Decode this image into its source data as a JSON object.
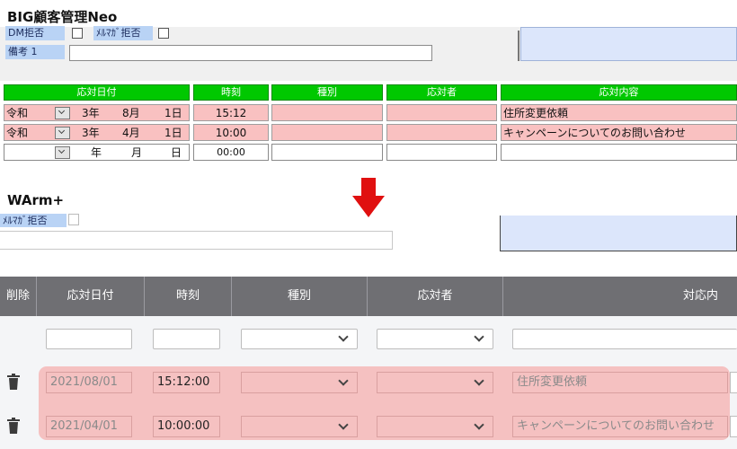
{
  "top": {
    "title": "BIG顧客管理Neo",
    "dm_label": "DM拒否",
    "mailmag_label": "ﾒﾙﾏｶﾞ拒否",
    "note_label": "備考 1",
    "headers": [
      "応対日付",
      "時刻",
      "種別",
      "応対者",
      "応対内容"
    ],
    "rows": [
      {
        "era": "令和",
        "year": "3年",
        "month": "8月",
        "day": "1日",
        "time": "15:12",
        "type": "",
        "staff": "",
        "content": "住所変更依頼"
      },
      {
        "era": "令和",
        "year": "3年",
        "month": "4月",
        "day": "1日",
        "time": "10:00",
        "type": "",
        "staff": "",
        "content": "キャンペーンについてのお問い合わせ"
      }
    ],
    "empty_row": {
      "year_unit": "年",
      "month_unit": "月",
      "day_unit": "日",
      "time": "00:00"
    }
  },
  "arrow": {
    "color": "#e01010"
  },
  "bottom": {
    "title": "WArm+",
    "mailmag_label": "ﾒﾙﾏｶﾞ拒否",
    "headers": [
      "削除",
      "応対日付",
      "時刻",
      "種別",
      "応対者",
      "対応内"
    ],
    "rows": [
      {
        "date": "2021/08/01",
        "time": "15:12:00",
        "type": "",
        "staff": "",
        "content": "住所変更依頼"
      },
      {
        "date": "2021/04/01",
        "time": "10:00:00",
        "type": "",
        "staff": "",
        "content": "キャンペーンについてのお問い合わせ"
      }
    ],
    "delete_icon": "trash-icon"
  },
  "colors": {
    "green_header": "#00c800",
    "pink_row": "#f9c1c1",
    "dark_header": "#6f6f73"
  }
}
